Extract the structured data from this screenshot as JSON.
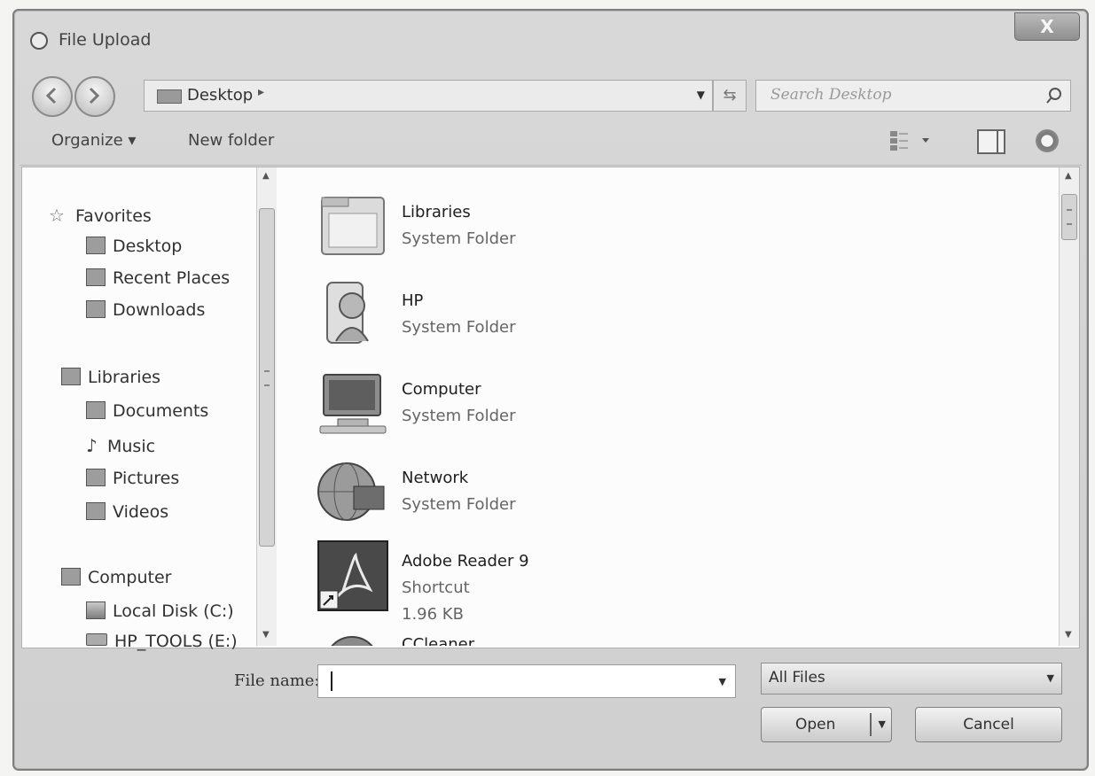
{
  "window": {
    "title": "File Upload",
    "close_label": "X"
  },
  "address_bar": {
    "location": "Desktop",
    "separator": "▸"
  },
  "search": {
    "placeholder": "Search Desktop"
  },
  "toolbar": {
    "organize_label": "Organize ▾",
    "new_folder_label": "New folder"
  },
  "nav_pane": {
    "favorites": {
      "label": "Favorites",
      "items": [
        "Desktop",
        "Recent Places",
        "Downloads"
      ]
    },
    "libraries": {
      "label": "Libraries",
      "items": [
        "Documents",
        "Music",
        "Pictures",
        "Videos"
      ]
    },
    "computer": {
      "label": "Computer",
      "items": [
        "Local Disk (C:)",
        "HP_TOOLS (E:)"
      ]
    }
  },
  "files": [
    {
      "name": "Libraries",
      "type": "System Folder",
      "size": ""
    },
    {
      "name": "HP",
      "type": "System Folder",
      "size": ""
    },
    {
      "name": "Computer",
      "type": "System Folder",
      "size": ""
    },
    {
      "name": "Network",
      "type": "System Folder",
      "size": ""
    },
    {
      "name": "Adobe Reader 9",
      "type": "Shortcut",
      "size": "1.96 KB"
    },
    {
      "name": "CCleaner",
      "type": "",
      "size": ""
    }
  ],
  "file_name": {
    "label": "File name:",
    "value": ""
  },
  "filter": {
    "selected": "All Files"
  },
  "buttons": {
    "open": "Open",
    "cancel": "Cancel"
  }
}
